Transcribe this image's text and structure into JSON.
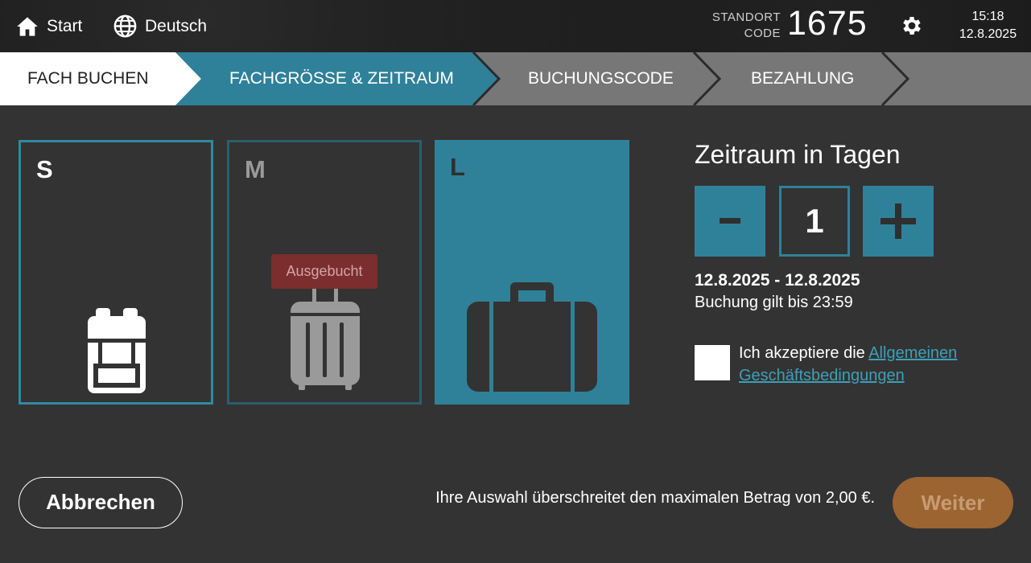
{
  "header": {
    "home_label": "Start",
    "language_label": "Deutsch",
    "standort_label_line1": "STANDORT",
    "standort_label_line2": "CODE",
    "standort_code": "1675",
    "time": "15:18",
    "date": "12.8.2025"
  },
  "steps": [
    {
      "label": "FACH BUCHEN",
      "state": "done"
    },
    {
      "label": "FACHGRÖSSE & ZEITRAUM",
      "state": "active"
    },
    {
      "label": "BUCHUNGSCODE",
      "state": "pending"
    },
    {
      "label": "BEZAHLUNG",
      "state": "pending"
    }
  ],
  "sizes": [
    {
      "letter": "S",
      "icon": "backpack-icon",
      "state": "available"
    },
    {
      "letter": "M",
      "icon": "trolley-suitcase-icon",
      "state": "booked_out",
      "badge": "Ausgebucht"
    },
    {
      "letter": "L",
      "icon": "suitcase-icon",
      "state": "selected"
    }
  ],
  "period": {
    "title": "Zeitraum in Tagen",
    "minus_label": "-",
    "plus_label": "+",
    "days": "1",
    "date_range": "12.8.2025 - 12.8.2025",
    "valid_until": "Buchung gilt bis 23:59"
  },
  "terms": {
    "prefix": "Ich akzeptiere die ",
    "link": "Allgemeinen Geschäftsbedingungen",
    "checked": false
  },
  "footer": {
    "cancel_label": "Abbrechen",
    "info_text": "Ihre Auswahl überschreitet den maximalen Betrag von 2,00 €.",
    "next_label": "Weiter"
  },
  "colors": {
    "accent": "#2f8199",
    "background": "#333333",
    "step_done": "#ffffff",
    "step_pending": "#777777",
    "badge_booked": "#7a2e2e",
    "next_button": "#9c6431"
  }
}
